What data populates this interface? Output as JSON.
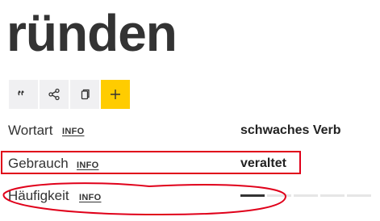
{
  "entry": {
    "headword": "ründen"
  },
  "toolbar": {
    "buttons": [
      {
        "icon": "quote-icon"
      },
      {
        "icon": "share-icon"
      },
      {
        "icon": "copy-icon"
      },
      {
        "icon": "plus-icon"
      }
    ],
    "accent_color": "#ffcc00"
  },
  "details": {
    "wortart": {
      "label": "Wortart",
      "info": "INFO",
      "value": "schwaches Verb"
    },
    "gebrauch": {
      "label": "Gebrauch",
      "info": "INFO",
      "value": "veraltet"
    },
    "haeufigkeit": {
      "label": "Häufigkeit",
      "info": "INFO",
      "level": 1,
      "max": 5
    }
  },
  "annotation_color": "#e0001a"
}
